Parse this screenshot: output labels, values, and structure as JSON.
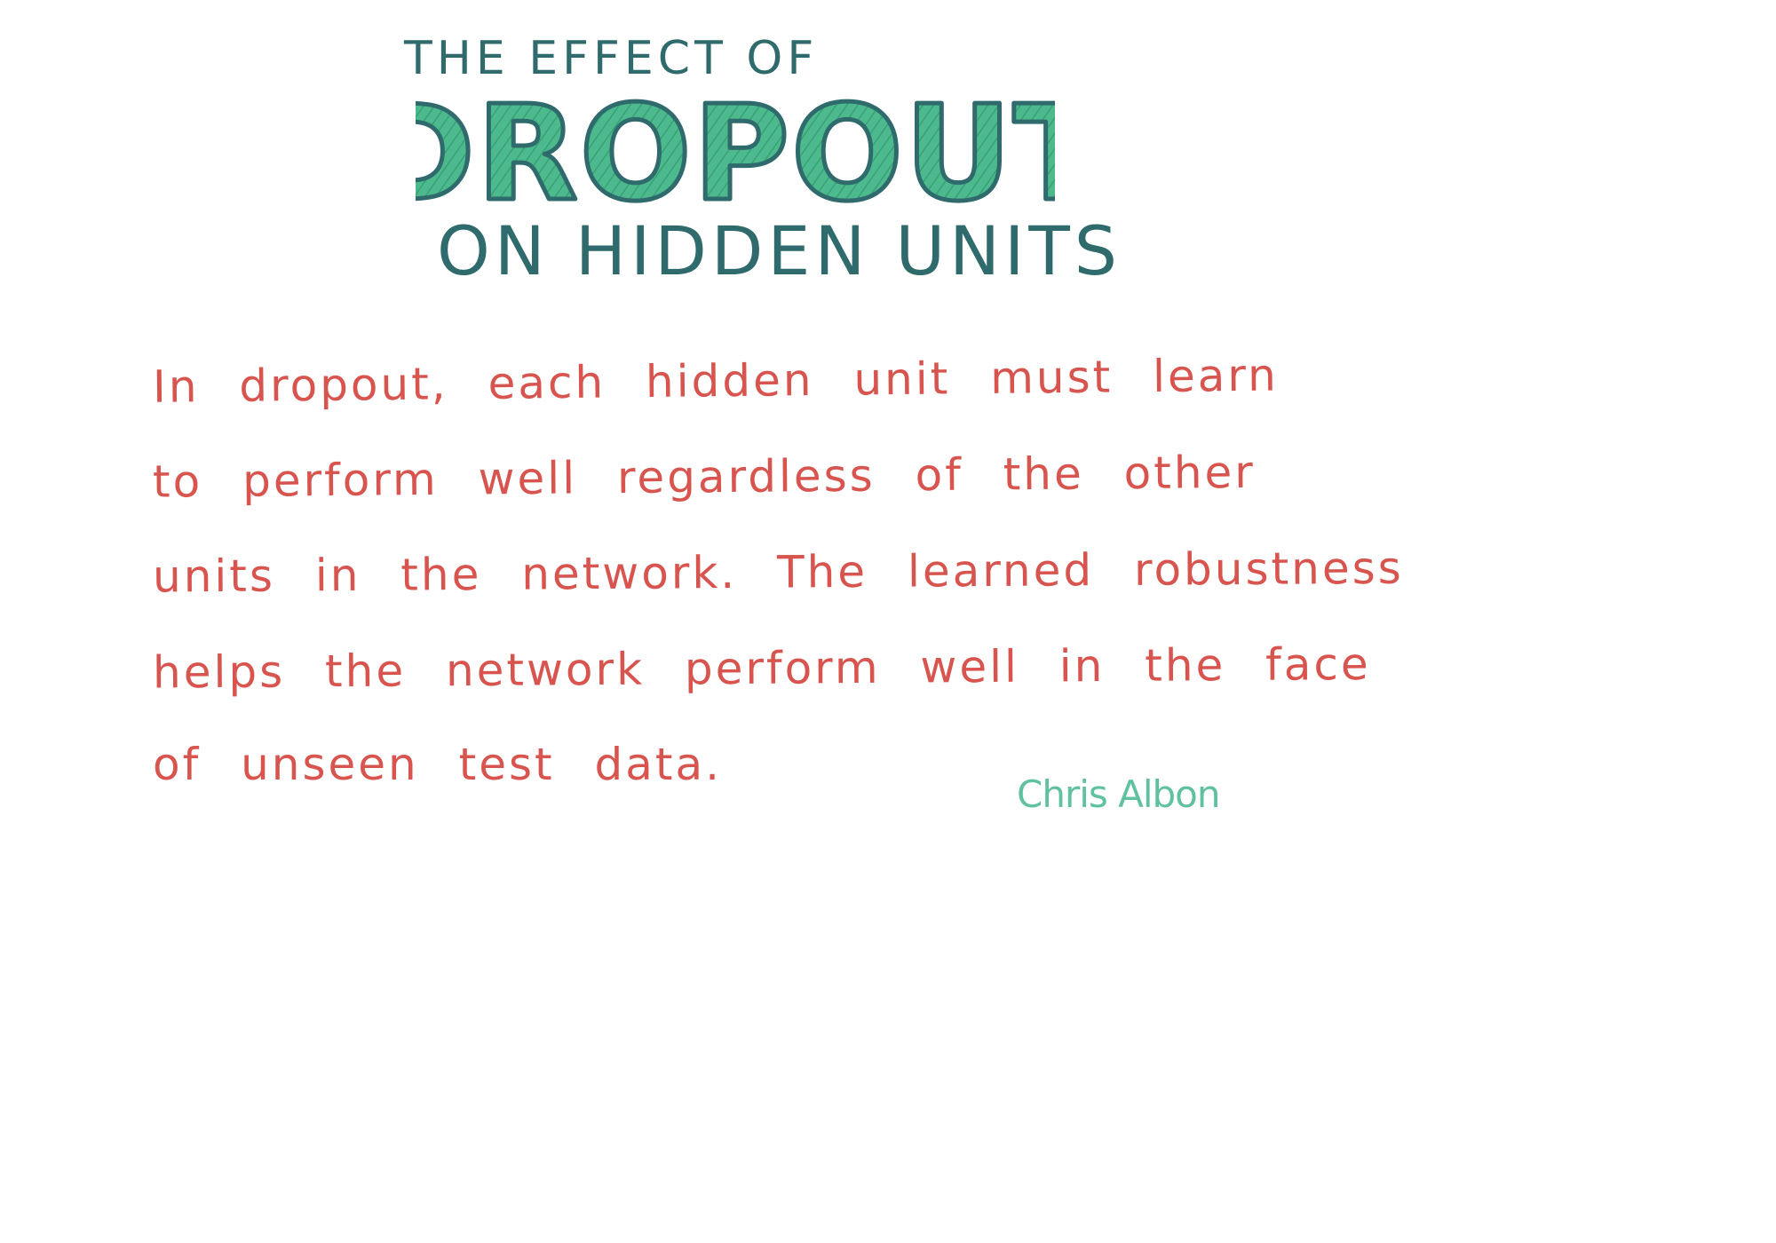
{
  "title": {
    "top": "THE EFFECT OF",
    "main": "DROPOUT",
    "bottom": "ON HIDDEN UNITS"
  },
  "body": {
    "lines": [
      "In dropout, each hidden unit must learn",
      "to perform well regardless of the other",
      "units in the network. The learned robustness",
      "helps the network perform well in the face",
      "of unseen test data."
    ]
  },
  "signature": "Chris Albon",
  "colors": {
    "title_ink": "#2f6b6c",
    "title_fill": "#4dba8e",
    "body_ink": "#d8554f",
    "signature_ink": "#5fc1a0",
    "background": "#ffffff"
  }
}
